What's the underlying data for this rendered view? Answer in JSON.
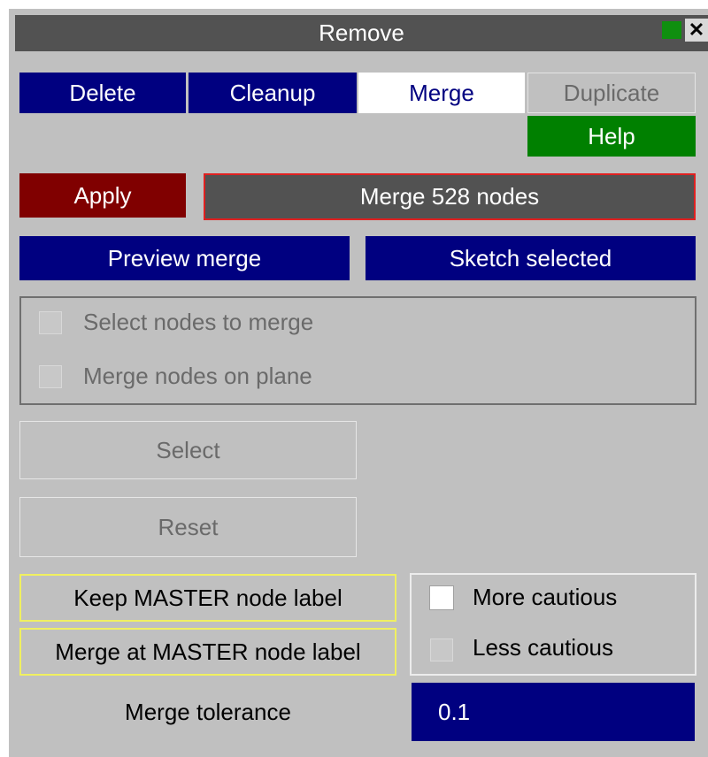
{
  "window": {
    "title": "Remove",
    "close_label": "✕"
  },
  "tabs": [
    {
      "label": "Delete",
      "state": "normal"
    },
    {
      "label": "Cleanup",
      "state": "normal"
    },
    {
      "label": "Merge",
      "state": "selected"
    },
    {
      "label": "Duplicate",
      "state": "disabled"
    }
  ],
  "help_label": "Help",
  "apply_label": "Apply",
  "merge_status": "Merge 528 nodes",
  "preview_merge_label": "Preview merge",
  "sketch_selected_label": "Sketch selected",
  "options": [
    {
      "label": "Select nodes to merge",
      "checked": false,
      "enabled": false
    },
    {
      "label": "Merge nodes on plane",
      "checked": false,
      "enabled": false
    }
  ],
  "select_label": "Select",
  "reset_label": "Reset",
  "keep_master_label": "Keep MASTER node label",
  "merge_at_master_label": "Merge at MASTER node label",
  "caution": [
    {
      "label": "More cautious",
      "checked": true
    },
    {
      "label": "Less cautious",
      "checked": false
    }
  ],
  "tolerance": {
    "label": "Merge tolerance",
    "value": "0.1"
  },
  "colors": {
    "panel": "#c0c0c0",
    "title_bar": "#525252",
    "navy": "#000080",
    "help_green": "#008000",
    "apply_red": "#800000",
    "highlight_yellow": "#f0f060"
  }
}
